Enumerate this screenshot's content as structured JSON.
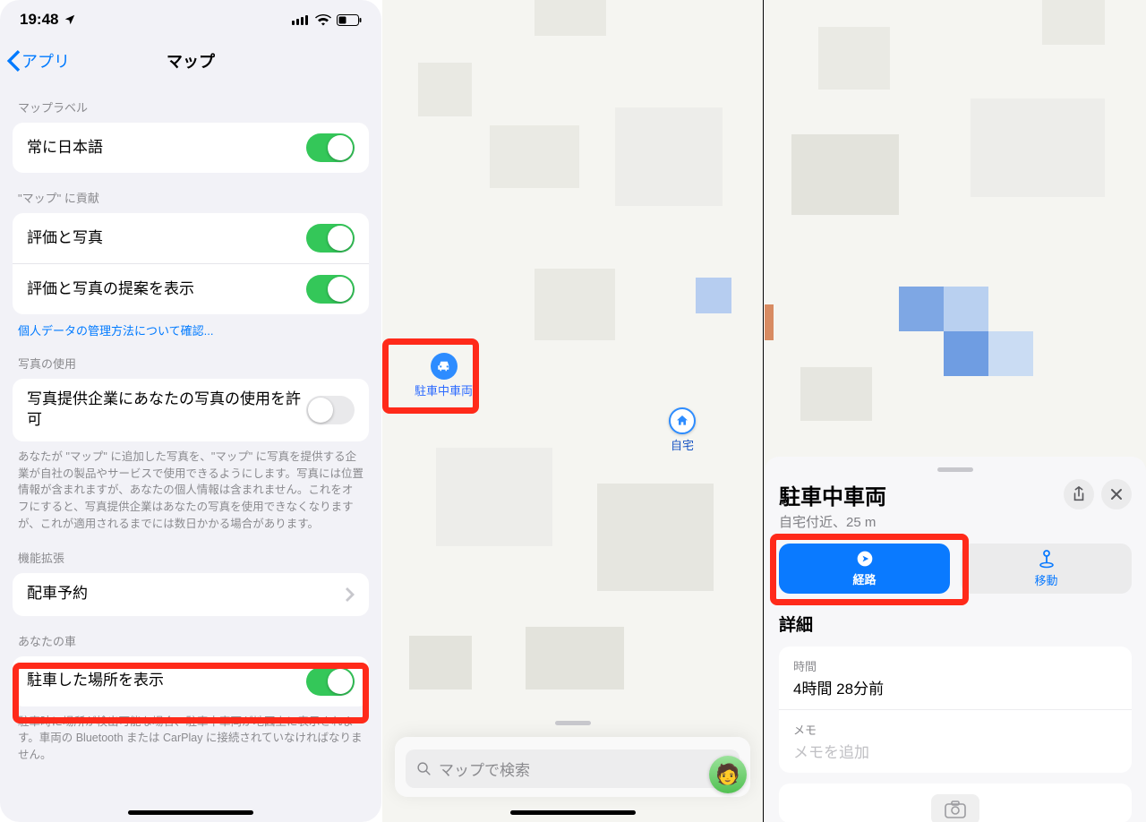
{
  "status_bar": {
    "time": "19:48"
  },
  "nav": {
    "back_label": "アプリ",
    "title": "マップ"
  },
  "sections": {
    "map_label": {
      "header": "マップラベル",
      "rows": {
        "always_japanese": "常に日本語"
      }
    },
    "contribute": {
      "header": "\"マップ\" に貢献",
      "rows": {
        "ratings_photos": "評価と写真",
        "show_suggestions": "評価と写真の提案を表示"
      },
      "privacy_link": "個人データの管理方法について確認..."
    },
    "photo_use": {
      "header": "写真の使用",
      "rows": {
        "allow_photo_use": "写真提供企業にあなたの写真の使用を許可"
      },
      "footer": "あなたが \"マップ\" に追加した写真を、\"マップ\" に写真を提供する企業が自社の製品やサービスで使用できるようにします。写真には位置情報が含まれますが、あなたの個人情報は含まれません。これをオフにすると、写真提供企業はあなたの写真を使用できなくなりますが、これが適用されるまでには数日かかる場合があります。"
    },
    "extensions": {
      "header": "機能拡張",
      "rows": {
        "ride_booking": "配車予約"
      }
    },
    "your_car": {
      "header": "あなたの車",
      "rows": {
        "show_parked": "駐車した場所を表示"
      },
      "footer": "駐車時に場所が検出可能な場合、駐車中車両が地図上に表示されます。車両の Bluetooth または CarPlay に接続されていなければなりません。"
    }
  },
  "mid_pane": {
    "parked_label": "駐車中車両",
    "home_label": "自宅",
    "search_placeholder": "マップで検索"
  },
  "right_pane": {
    "title": "駐車中車両",
    "subtitle": "自宅付近、25 m",
    "route_btn": "経路",
    "move_btn": "移動",
    "details_header": "詳細",
    "time_label": "時間",
    "time_value": "4時間 28分前",
    "memo_label": "メモ",
    "memo_placeholder": "メモを追加"
  }
}
